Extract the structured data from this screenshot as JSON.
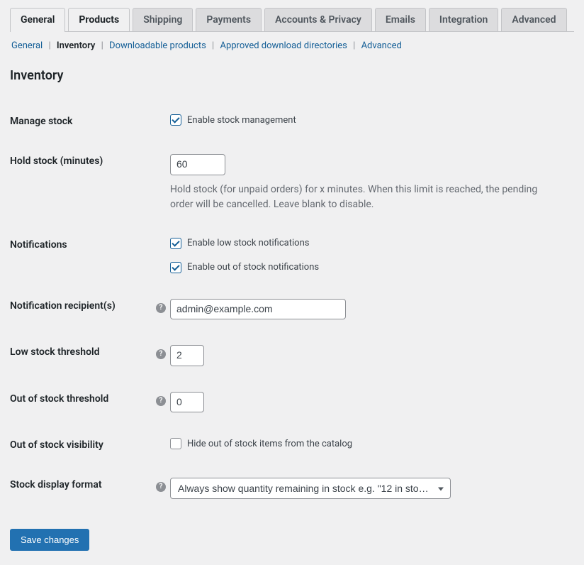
{
  "top_tabs": {
    "general": "General",
    "products": "Products",
    "shipping": "Shipping",
    "payments": "Payments",
    "accounts": "Accounts & Privacy",
    "emails": "Emails",
    "integration": "Integration",
    "advanced": "Advanced"
  },
  "subnav": {
    "general": "General",
    "inventory": "Inventory",
    "downloadable": "Downloadable products",
    "approved": "Approved download directories",
    "advanced": "Advanced"
  },
  "section_title": "Inventory",
  "fields": {
    "manage_stock": {
      "label": "Manage stock",
      "checkbox_label": "Enable stock management",
      "checked": true
    },
    "hold_stock": {
      "label": "Hold stock (minutes)",
      "value": "60",
      "description": "Hold stock (for unpaid orders) for x minutes. When this limit is reached, the pending order will be cancelled. Leave blank to disable."
    },
    "notifications": {
      "label": "Notifications",
      "low_stock_label": "Enable low stock notifications",
      "low_stock_checked": true,
      "out_of_stock_label": "Enable out of stock notifications",
      "out_of_stock_checked": true
    },
    "recipients": {
      "label": "Notification recipient(s)",
      "value": "admin@example.com"
    },
    "low_threshold": {
      "label": "Low stock threshold",
      "value": "2"
    },
    "out_threshold": {
      "label": "Out of stock threshold",
      "value": "0"
    },
    "out_visibility": {
      "label": "Out of stock visibility",
      "checkbox_label": "Hide out of stock items from the catalog",
      "checked": false
    },
    "display_format": {
      "label": "Stock display format",
      "selected": "Always show quantity remaining in stock e.g. \"12 in sto…"
    }
  },
  "submit": {
    "save": "Save changes"
  },
  "help_glyph": "?"
}
